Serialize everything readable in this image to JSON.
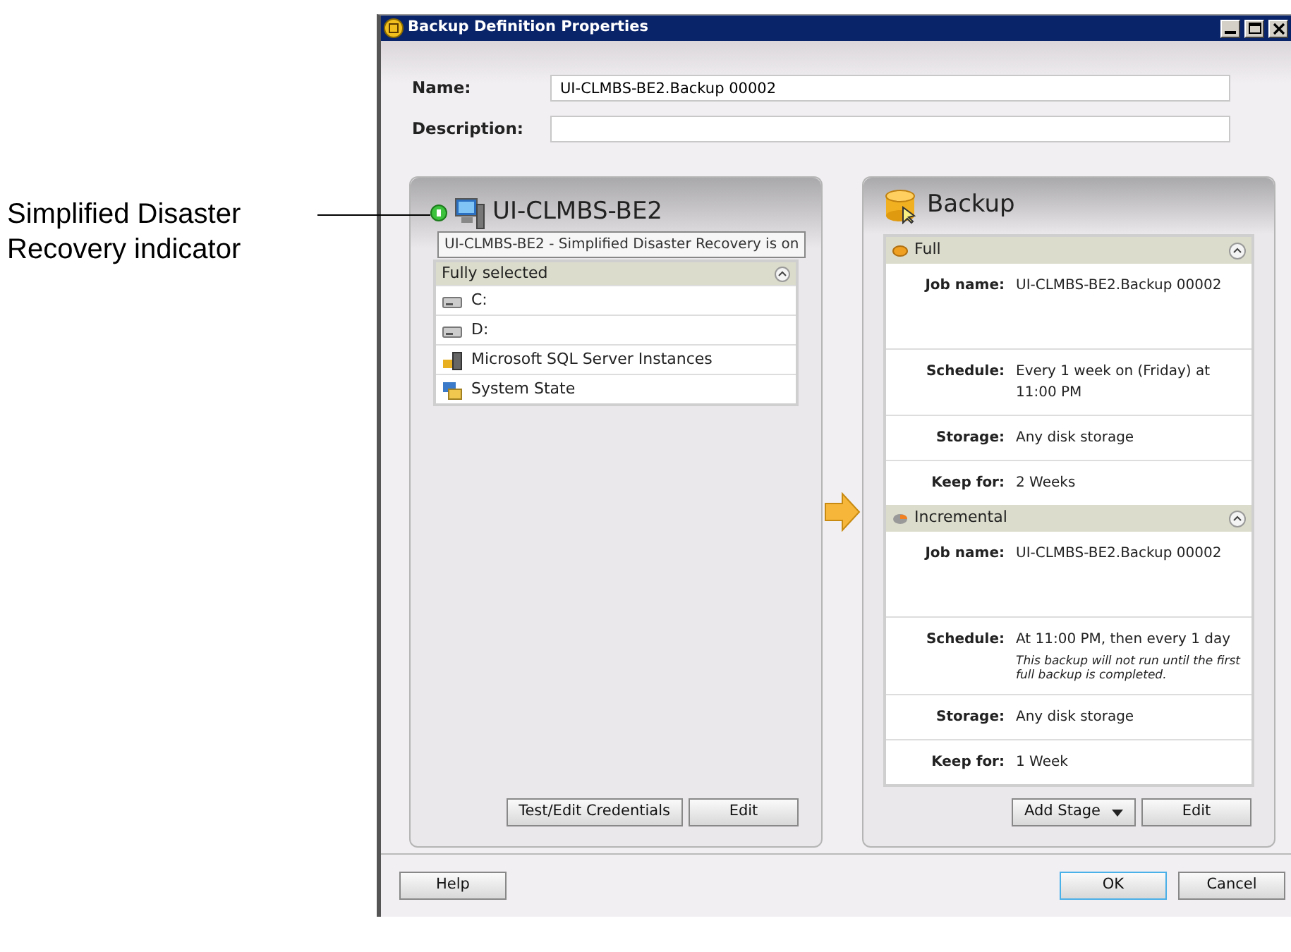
{
  "annotation": {
    "text": "Simplified Disaster Recovery indicator"
  },
  "window": {
    "title": "Backup Definition Properties"
  },
  "fields": [
    {
      "label": "Name:",
      "value": "UI-CLMBS-BE2.Backup 00002"
    },
    {
      "label": "Description:"
    }
  ],
  "source": {
    "title": "UI-CLMBS-BE2",
    "sdr_on": true,
    "tooltip": "UI-CLMBS-BE2 - Simplified Disaster Recovery is on",
    "selection": {
      "header": "Fully selected",
      "expanded": true,
      "items": [
        {
          "label": "C:",
          "kind": "drive"
        },
        {
          "label": "D:",
          "kind": "drive"
        },
        {
          "label": "Microsoft SQL Server Instances",
          "kind": "sql"
        },
        {
          "label": "System State",
          "kind": "system"
        }
      ]
    },
    "buttons": [
      {
        "label": "Test/Edit Credentials"
      },
      {
        "label": "Edit"
      }
    ]
  },
  "target": {
    "title": "Backup",
    "stages": [
      {
        "kind": "full",
        "title": "Full",
        "expanded": true,
        "rows": [
          {
            "label": "Job name:",
            "value": "UI-CLMBS-BE2.Backup 00002"
          },
          {
            "label": "Schedule:",
            "value": "Every 1 week on (Friday) at 11:00 PM"
          },
          {
            "label": "Storage:",
            "value": "Any disk storage"
          },
          {
            "label": "Keep for:",
            "value": "2 Weeks"
          }
        ]
      },
      {
        "kind": "incremental",
        "title": "Incremental",
        "expanded": true,
        "rows": [
          {
            "label": "Job name:",
            "value": "UI-CLMBS-BE2.Backup 00002"
          },
          {
            "label": "Schedule:",
            "value": "At 11:00 PM, then every 1 day",
            "note": "This backup will not run until the first full backup is completed."
          },
          {
            "label": "Storage:",
            "value": "Any disk storage"
          },
          {
            "label": "Keep for:",
            "value": "1 Week"
          }
        ]
      }
    ],
    "buttons": [
      {
        "label": "Add Stage",
        "dropdown": true
      },
      {
        "label": "Edit",
        "dropdown": false
      }
    ]
  },
  "footer": {
    "buttons": [
      {
        "label": "Help",
        "default": false
      },
      {
        "label": "OK",
        "default": true
      },
      {
        "label": "Cancel",
        "default": false
      }
    ]
  }
}
